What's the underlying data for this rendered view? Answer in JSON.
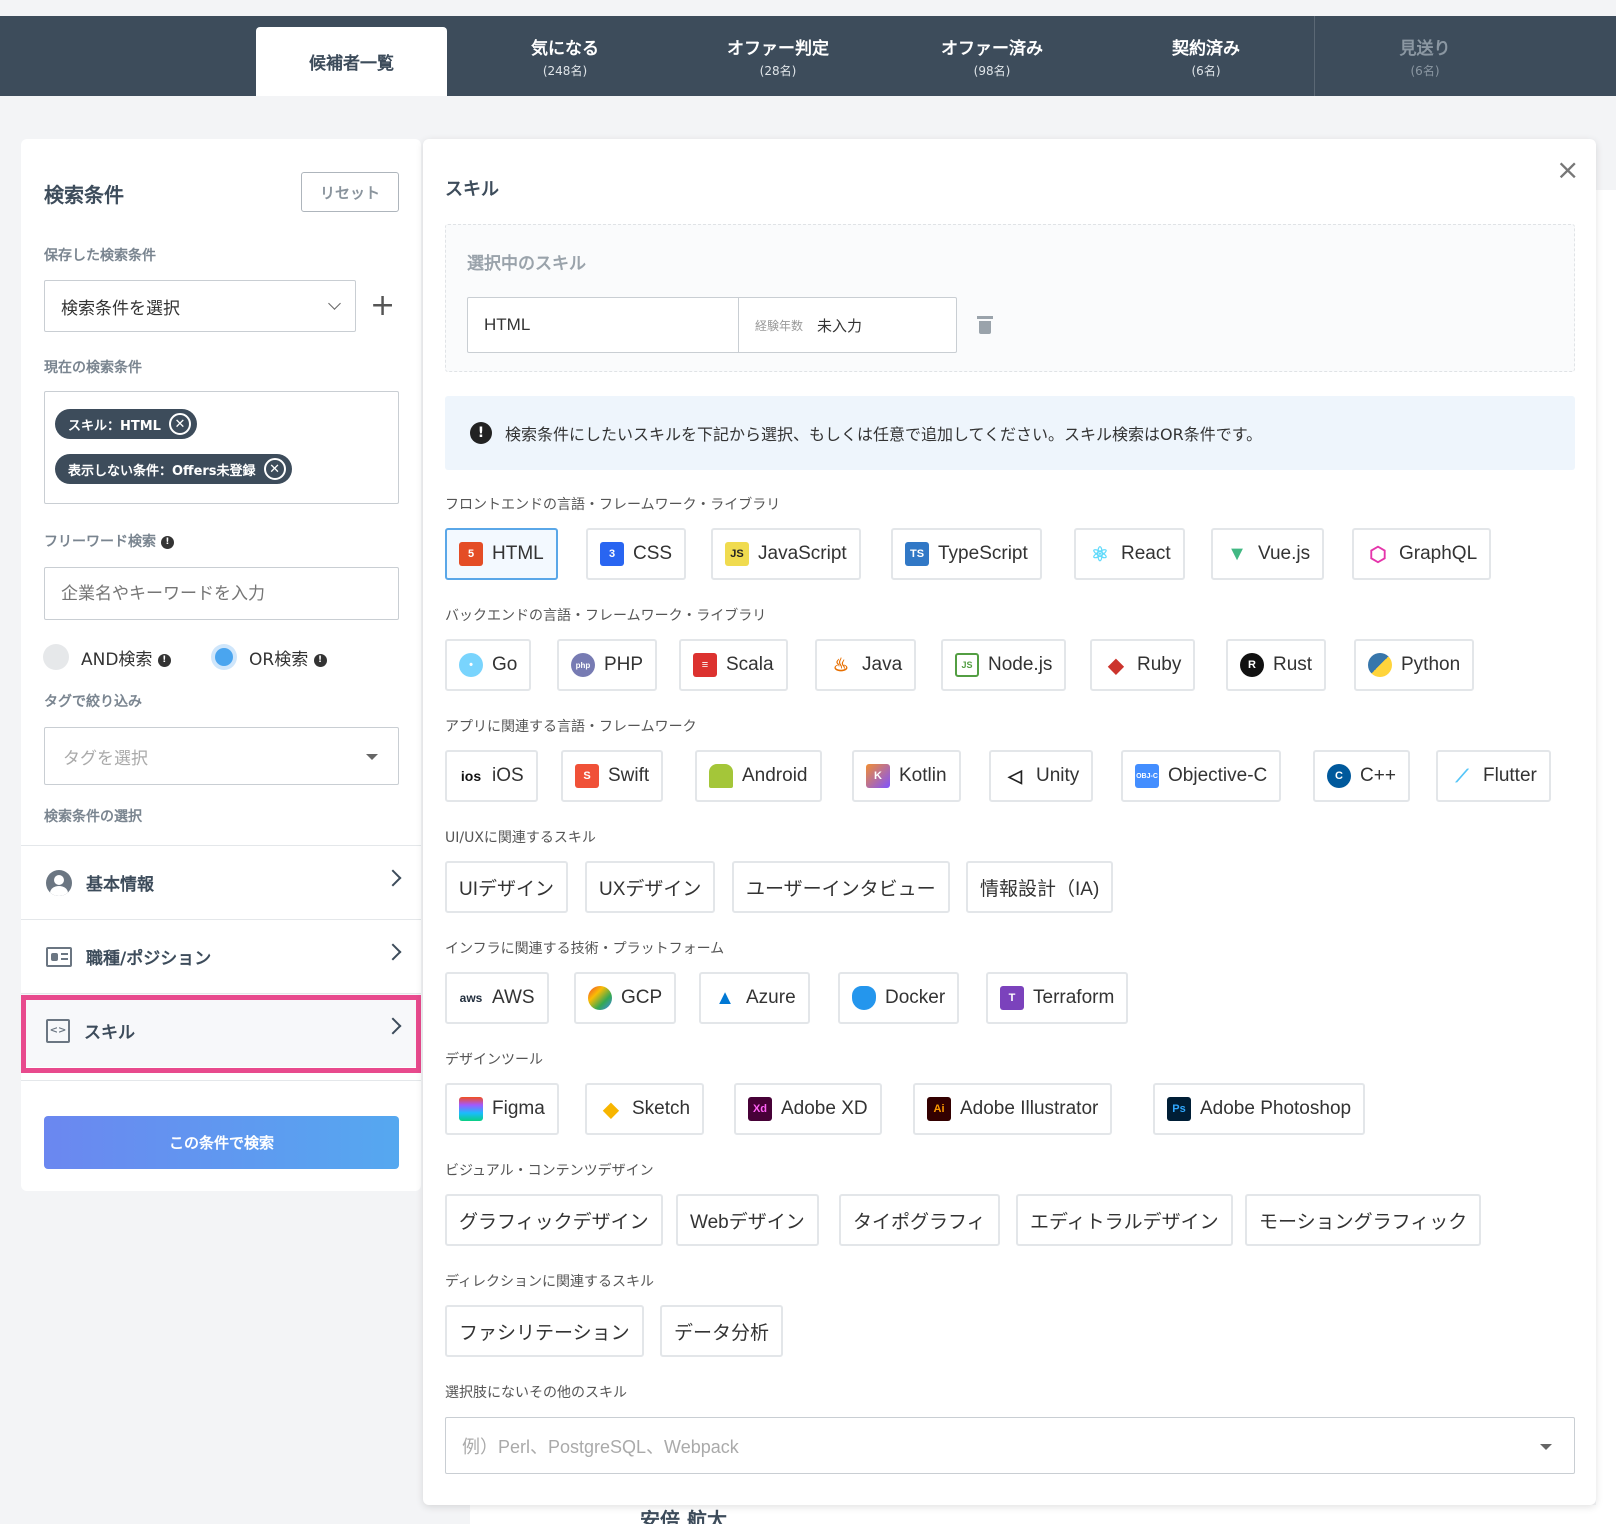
{
  "tabs": [
    {
      "label": "候補者一覧",
      "count": ""
    },
    {
      "label": "気になる",
      "count": "(248名)"
    },
    {
      "label": "オファー判定",
      "count": "(28名)"
    },
    {
      "label": "オファー済み",
      "count": "(98名)"
    },
    {
      "label": "契約済み",
      "count": "(6名)"
    },
    {
      "label": "見送り",
      "count": "(6名)"
    }
  ],
  "sidebar": {
    "title": "検索条件",
    "reset": "リセット",
    "saved_label": "保存した検索条件",
    "saved_select": "検索条件を選択",
    "current_label": "現在の検索条件",
    "chips": [
      "スキル：HTML",
      "表示しない条件：Offers未登録"
    ],
    "freeword_label": "フリーワード検索",
    "freeword_placeholder": "企業名やキーワードを入力",
    "and_label": "AND検索",
    "or_label": "OR検索",
    "tag_label": "タグで絞り込み",
    "tag_placeholder": "タグを選択",
    "select_label": "検索条件の選択",
    "nav": [
      "基本情報",
      "職種/ポジション",
      "スキル"
    ],
    "search_button": "この条件で検索"
  },
  "modal": {
    "title": "スキル",
    "close": "×",
    "selected_title": "選択中のスキル",
    "selected_skill": "HTML",
    "years_label": "経験年数",
    "years_value": "未入力",
    "notice": "検索条件にしたいスキルを下記から選択、もしくは任意で追加してください。スキル検索はOR条件です。",
    "sections": [
      {
        "title": "フロントエンドの言語・フレームワーク・ライブラリ",
        "skills": [
          "HTML",
          "CSS",
          "JavaScript",
          "TypeScript",
          "React",
          "Vue.js",
          "GraphQL"
        ]
      },
      {
        "title": "バックエンドの言語・フレームワーク・ライブラリ",
        "skills": [
          "Go",
          "PHP",
          "Scala",
          "Java",
          "Node.js",
          "Ruby",
          "Rust",
          "Python"
        ]
      },
      {
        "title": "アプリに関連する言語・フレームワーク",
        "skills": [
          "iOS",
          "Swift",
          "Android",
          "Kotlin",
          "Unity",
          "Objective-C",
          "C++",
          "Flutter"
        ]
      },
      {
        "title": "UI/UXに関連するスキル",
        "skills": [
          "UIデザイン",
          "UXデザイン",
          "ユーザーインタビュー",
          "情報設計（IA)"
        ]
      },
      {
        "title": "インフラに関連する技術・プラットフォーム",
        "skills": [
          "AWS",
          "GCP",
          "Azure",
          "Docker",
          "Terraform"
        ]
      },
      {
        "title": "デザインツール",
        "skills": [
          "Figma",
          "Sketch",
          "Adobe XD",
          "Adobe Illustrator",
          "Adobe Photoshop"
        ]
      },
      {
        "title": "ビジュアル・コンテンツデザイン",
        "skills": [
          "グラフィックデザイン",
          "Webデザイン",
          "タイポグラフィ",
          "エディトラルデザイン",
          "モーショングラフィック"
        ]
      },
      {
        "title": "ディレクションに関連するスキル",
        "skills": [
          "ファシリテーション",
          "データ分析"
        ]
      }
    ],
    "other_title": "選択肢にないその他のスキル",
    "other_placeholder": "例）Perl、PostgreSQL、Webpack"
  },
  "background_name": "安倍 航太",
  "colors": {
    "header": "#3d4c5b",
    "accent": "#5aa7e8",
    "highlight": "#e84a8d",
    "button": "#6b8ff0"
  }
}
